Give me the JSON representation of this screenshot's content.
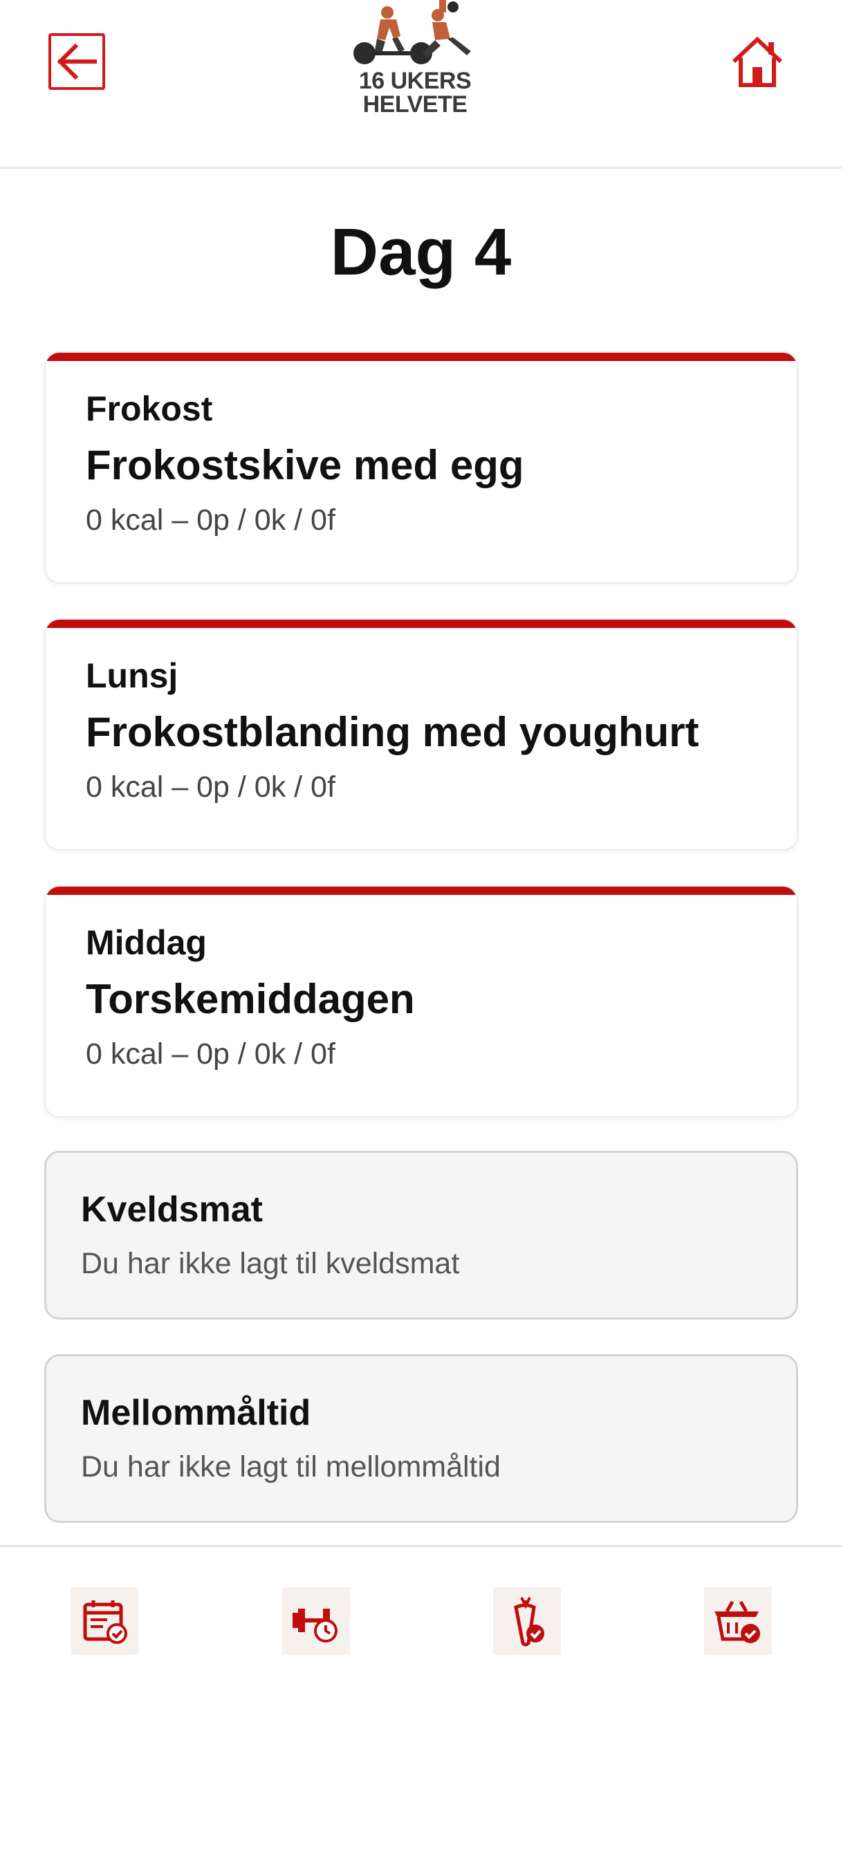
{
  "header": {
    "back_icon": "arrow-left-icon",
    "home_icon": "home-icon",
    "logo_line1": "16 UKERS",
    "logo_line2": "HELVETE"
  },
  "page": {
    "title": "Dag 4"
  },
  "meals": [
    {
      "type": "Frokost",
      "name": "Frokostskive med egg",
      "macros": "0 kcal – 0p / 0k / 0f"
    },
    {
      "type": "Lunsj",
      "name": "Frokostblanding med youghurt",
      "macros": "0 kcal – 0p / 0k / 0f"
    },
    {
      "type": "Middag",
      "name": "Torskemiddagen",
      "macros": "0 kcal – 0p / 0k / 0f"
    }
  ],
  "empty_meals": [
    {
      "type": "Kveldsmat",
      "text": "Du har ikke lagt til kveldsmat"
    },
    {
      "type": "Mellommåltid",
      "text": "Du har ikke lagt til mellommåltid"
    }
  ],
  "bottom_nav": {
    "items": [
      "calendar-check-icon",
      "dumbbell-timer-icon",
      "carrot-check-icon",
      "basket-check-icon"
    ]
  },
  "colors": {
    "accent": "#c00d0d",
    "icon_red": "#d11b1b",
    "card_gray": "#f5f5f5"
  }
}
